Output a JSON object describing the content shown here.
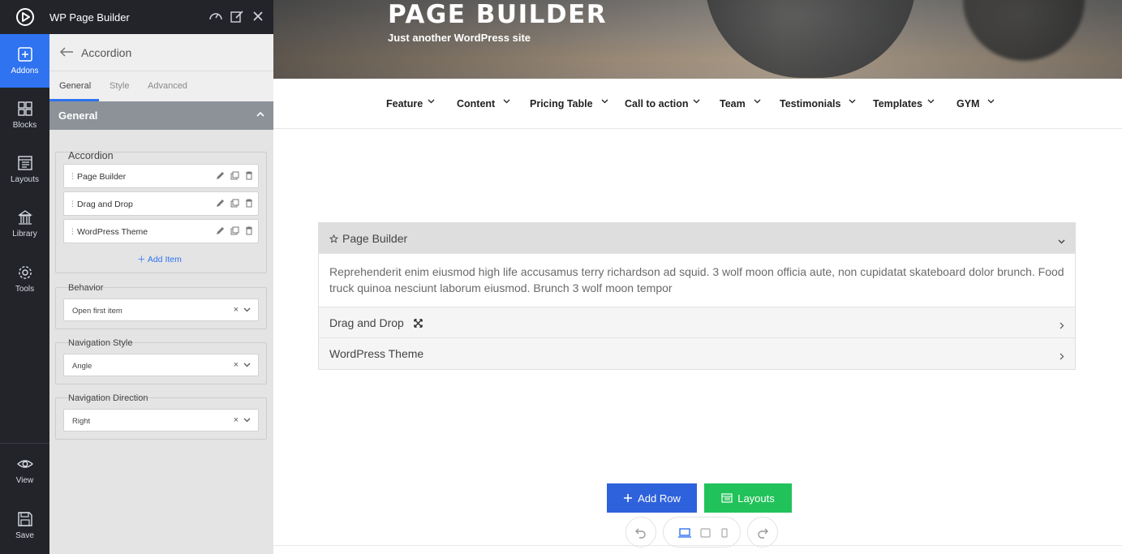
{
  "app": {
    "title": "WP Page Builder"
  },
  "rail": {
    "items": [
      {
        "label": "Addons",
        "icon": "plus-square-icon",
        "active": true
      },
      {
        "label": "Blocks",
        "icon": "grid-icon"
      },
      {
        "label": "Layouts",
        "icon": "layout-icon"
      },
      {
        "label": "Library",
        "icon": "library-icon"
      },
      {
        "label": "Tools",
        "icon": "gear-icon"
      }
    ],
    "bottom": [
      {
        "label": "View",
        "icon": "eye-icon"
      },
      {
        "label": "Save",
        "icon": "save-icon"
      }
    ]
  },
  "panel": {
    "breadcrumb": "Accordion",
    "tabs": [
      "General",
      "Style",
      "Advanced"
    ],
    "active_tab": "General",
    "section_title": "General",
    "accordion_group": {
      "label": "Accordion",
      "items": [
        "Page Builder",
        "Drag and Drop",
        "WordPress Theme"
      ],
      "add_label": "Add Item"
    },
    "behavior": {
      "label": "Behavior",
      "value": "Open first item"
    },
    "navigation_style": {
      "label": "Navigation Style",
      "value": "Angle"
    },
    "navigation_direction": {
      "label": "Navigation Direction",
      "value": "Right"
    }
  },
  "site": {
    "title": "PAGE BUILDER",
    "tagline": "Just another WordPress site",
    "nav": [
      "Feature",
      "Content",
      "Pricing Table",
      "Call to action",
      "Team",
      "Testimonials",
      "Templates",
      "GYM"
    ]
  },
  "accordion": {
    "items": [
      {
        "title": "Page Builder",
        "open": true,
        "body": "Reprehenderit enim eiusmod high life accusamus terry richardson ad squid. 3 wolf moon officia aute, non cupidatat skateboard dolor brunch. Food truck quinoa nesciunt laborum eiusmod. Brunch 3 wolf moon tempor"
      },
      {
        "title": "Drag and Drop",
        "open": false
      },
      {
        "title": "WordPress Theme",
        "open": false
      }
    ]
  },
  "actions": {
    "add_row": "Add Row",
    "layouts": "Layouts"
  },
  "colors": {
    "rail_bg": "#22242a",
    "accent_blue": "#2f73f0",
    "add_row_bg": "#2e62dc",
    "layouts_bg": "#22c25a"
  }
}
